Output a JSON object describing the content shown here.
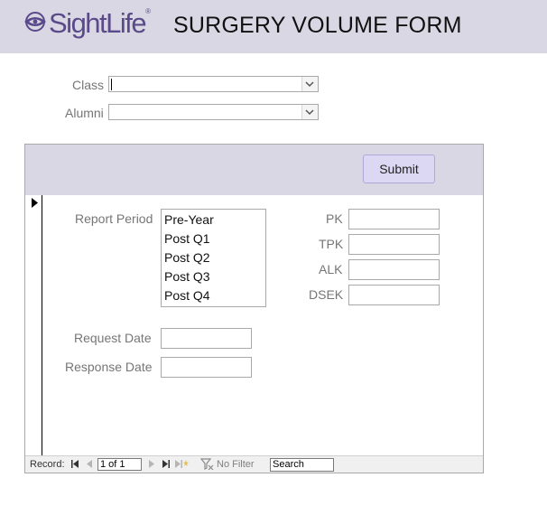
{
  "header": {
    "logo_text": "SightLife",
    "logo_mark": "®",
    "title": "SURGERY VOLUME FORM"
  },
  "filters": {
    "class_label": "Class",
    "class_value": "",
    "alumni_label": "Alumni",
    "alumni_value": ""
  },
  "subform": {
    "submit_label": "Submit",
    "report_period_label": "Report Period",
    "report_period_options": [
      "Pre-Year",
      "Post Q1",
      "Post Q2",
      "Post Q3",
      "Post Q4"
    ],
    "fields": [
      {
        "label": "PK",
        "value": ""
      },
      {
        "label": "TPK",
        "value": ""
      },
      {
        "label": "ALK",
        "value": ""
      },
      {
        "label": "DSEK",
        "value": ""
      }
    ],
    "request_date_label": "Request Date",
    "request_date_value": "",
    "response_date_label": "Response Date",
    "response_date_value": ""
  },
  "navigation": {
    "record_label": "Record:",
    "record_position": "1 of 1",
    "filter_label": "No Filter",
    "search_placeholder": "Search"
  },
  "colors": {
    "header_bg": "#d9d7e3",
    "brand_purple": "#5a4a8a",
    "button_bg": "#dcd7f2"
  }
}
